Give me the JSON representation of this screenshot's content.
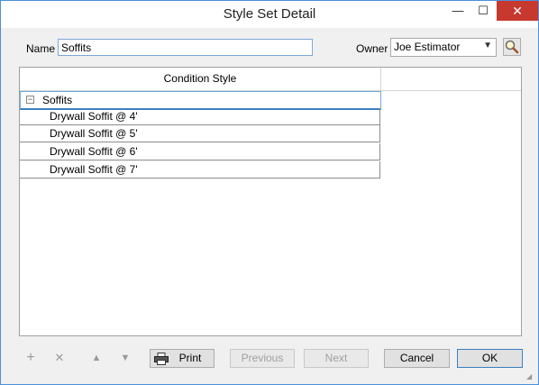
{
  "window": {
    "title": "Style Set Detail",
    "min_glyph": "—",
    "max_glyph": "☐",
    "close_glyph": "✕"
  },
  "form": {
    "name_label": "Name",
    "name_value": "Soffits",
    "owner_label": "Owner",
    "owner_value": "Joe Estimator"
  },
  "grid": {
    "column_header": "Condition Style",
    "group_label": "Soffits",
    "rows": [
      "Drywall Soffit @ 4'",
      "Drywall Soffit @ 5'",
      "Drywall Soffit @ 6'",
      "Drywall Soffit @ 7'"
    ]
  },
  "toolbar": {
    "add_glyph": "+",
    "delete_glyph": "✕",
    "up_glyph": "▲",
    "down_glyph": "▼",
    "print_label": "Print",
    "previous_label": "Previous",
    "next_label": "Next",
    "cancel_label": "Cancel",
    "ok_label": "OK"
  },
  "icons": {
    "search": "search-icon",
    "printer": "printer-icon"
  }
}
